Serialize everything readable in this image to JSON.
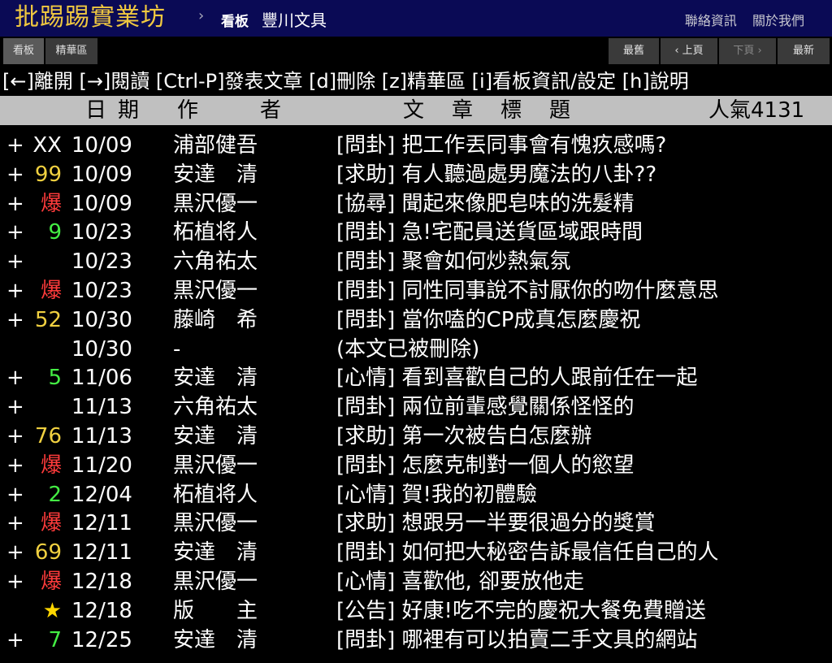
{
  "header": {
    "logo": "批踢踢實業坊",
    "separator": "›",
    "board_label": "看板",
    "board_name": "豐川文具",
    "links": [
      "聯絡資訊",
      "關於我們"
    ]
  },
  "toolbar": {
    "tab_board": "看板",
    "tab_digest": "精華區",
    "oldest": "最舊",
    "prev": "‹ 上頁",
    "next": "下頁 ›",
    "newest": "最新"
  },
  "command_bar": "[←]離開 [→]閱讀 [Ctrl-P]發表文章 [d]刪除 [z]精華區 [i]看板資訊/設定 [h]說明",
  "list_header": {
    "date": "日期",
    "author": "作　　者",
    "title": "文　章　標　題",
    "popularity": "人氣4131"
  },
  "colors": {
    "push_red": "#ff3b3b",
    "push_yellow": "#f0d040",
    "push_green": "#44ee44",
    "star": "#ffd700",
    "header_bg": "#0a0a55",
    "logo": "#f0c840"
  },
  "posts": [
    {
      "mark": "+",
      "push": "XX",
      "push_color": "white",
      "date": "10/09",
      "author": "浦部健吾",
      "title": "[問卦] 把工作丟同事會有愧疚感嗎?"
    },
    {
      "mark": "+",
      "push": "99",
      "push_color": "yellow",
      "date": "10/09",
      "author": "安達　清",
      "title": "[求助] 有人聽過處男魔法的八卦??"
    },
    {
      "mark": "+",
      "push": "爆",
      "push_color": "red",
      "date": "10/09",
      "author": "黒沢優一",
      "title": "[協尋] 聞起來像肥皂味的洗髮精"
    },
    {
      "mark": "+",
      "push": "9",
      "push_color": "green",
      "date": "10/23",
      "author": "柘植将人",
      "title": "[問卦] 急!宅配員送貨區域跟時間"
    },
    {
      "mark": "+",
      "push": "",
      "push_color": "white",
      "date": "10/23",
      "author": "六角祐太",
      "title": "[問卦] 聚會如何炒熱氣氛"
    },
    {
      "mark": "+",
      "push": "爆",
      "push_color": "red",
      "date": "10/23",
      "author": "黒沢優一",
      "title": "[問卦] 同性同事說不討厭你的吻什麼意思"
    },
    {
      "mark": "+",
      "push": "52",
      "push_color": "yellow",
      "date": "10/30",
      "author": "藤崎　希",
      "title": "[問卦] 當你嗑的CP成真怎麼慶祝"
    },
    {
      "mark": "",
      "push": "",
      "push_color": "white",
      "date": "10/30",
      "author": "-",
      "title": "(本文已被刪除)"
    },
    {
      "mark": "+",
      "push": "5",
      "push_color": "green",
      "date": "11/06",
      "author": "安達　清",
      "title": "[心情] 看到喜歡自己的人跟前任在一起"
    },
    {
      "mark": "+",
      "push": "",
      "push_color": "white",
      "date": "11/13",
      "author": "六角祐太",
      "title": "[問卦] 兩位前輩感覺關係怪怪的"
    },
    {
      "mark": "+",
      "push": "76",
      "push_color": "yellow",
      "date": "11/13",
      "author": "安達　清",
      "title": "[求助] 第一次被告白怎麼辦"
    },
    {
      "mark": "+",
      "push": "爆",
      "push_color": "red",
      "date": "11/20",
      "author": "黒沢優一",
      "title": "[問卦] 怎麼克制對一個人的慾望"
    },
    {
      "mark": "+",
      "push": "2",
      "push_color": "green",
      "date": "12/04",
      "author": "柘植将人",
      "title": "[心情] 賀!我的初體驗"
    },
    {
      "mark": "+",
      "push": "爆",
      "push_color": "red",
      "date": "12/11",
      "author": "黒沢優一",
      "title": "[求助] 想跟另一半要很過分的獎賞"
    },
    {
      "mark": "+",
      "push": "69",
      "push_color": "yellow",
      "date": "12/11",
      "author": "安達　清",
      "title": "[問卦] 如何把大秘密告訴最信任自己的人"
    },
    {
      "mark": "+",
      "push": "爆",
      "push_color": "red",
      "date": "12/18",
      "author": "黒沢優一",
      "title": "[心情] 喜歡他, 卻要放他走"
    },
    {
      "mark": "",
      "push": "★",
      "push_color": "star",
      "date": "12/18",
      "author": "版　　主",
      "title": "[公告] 好康!吃不完的慶祝大餐免費贈送"
    },
    {
      "mark": "+",
      "push": "7",
      "push_color": "green",
      "date": "12/25",
      "author": "安達　清",
      "title": "[問卦] 哪裡有可以拍賣二手文具的網站"
    }
  ]
}
